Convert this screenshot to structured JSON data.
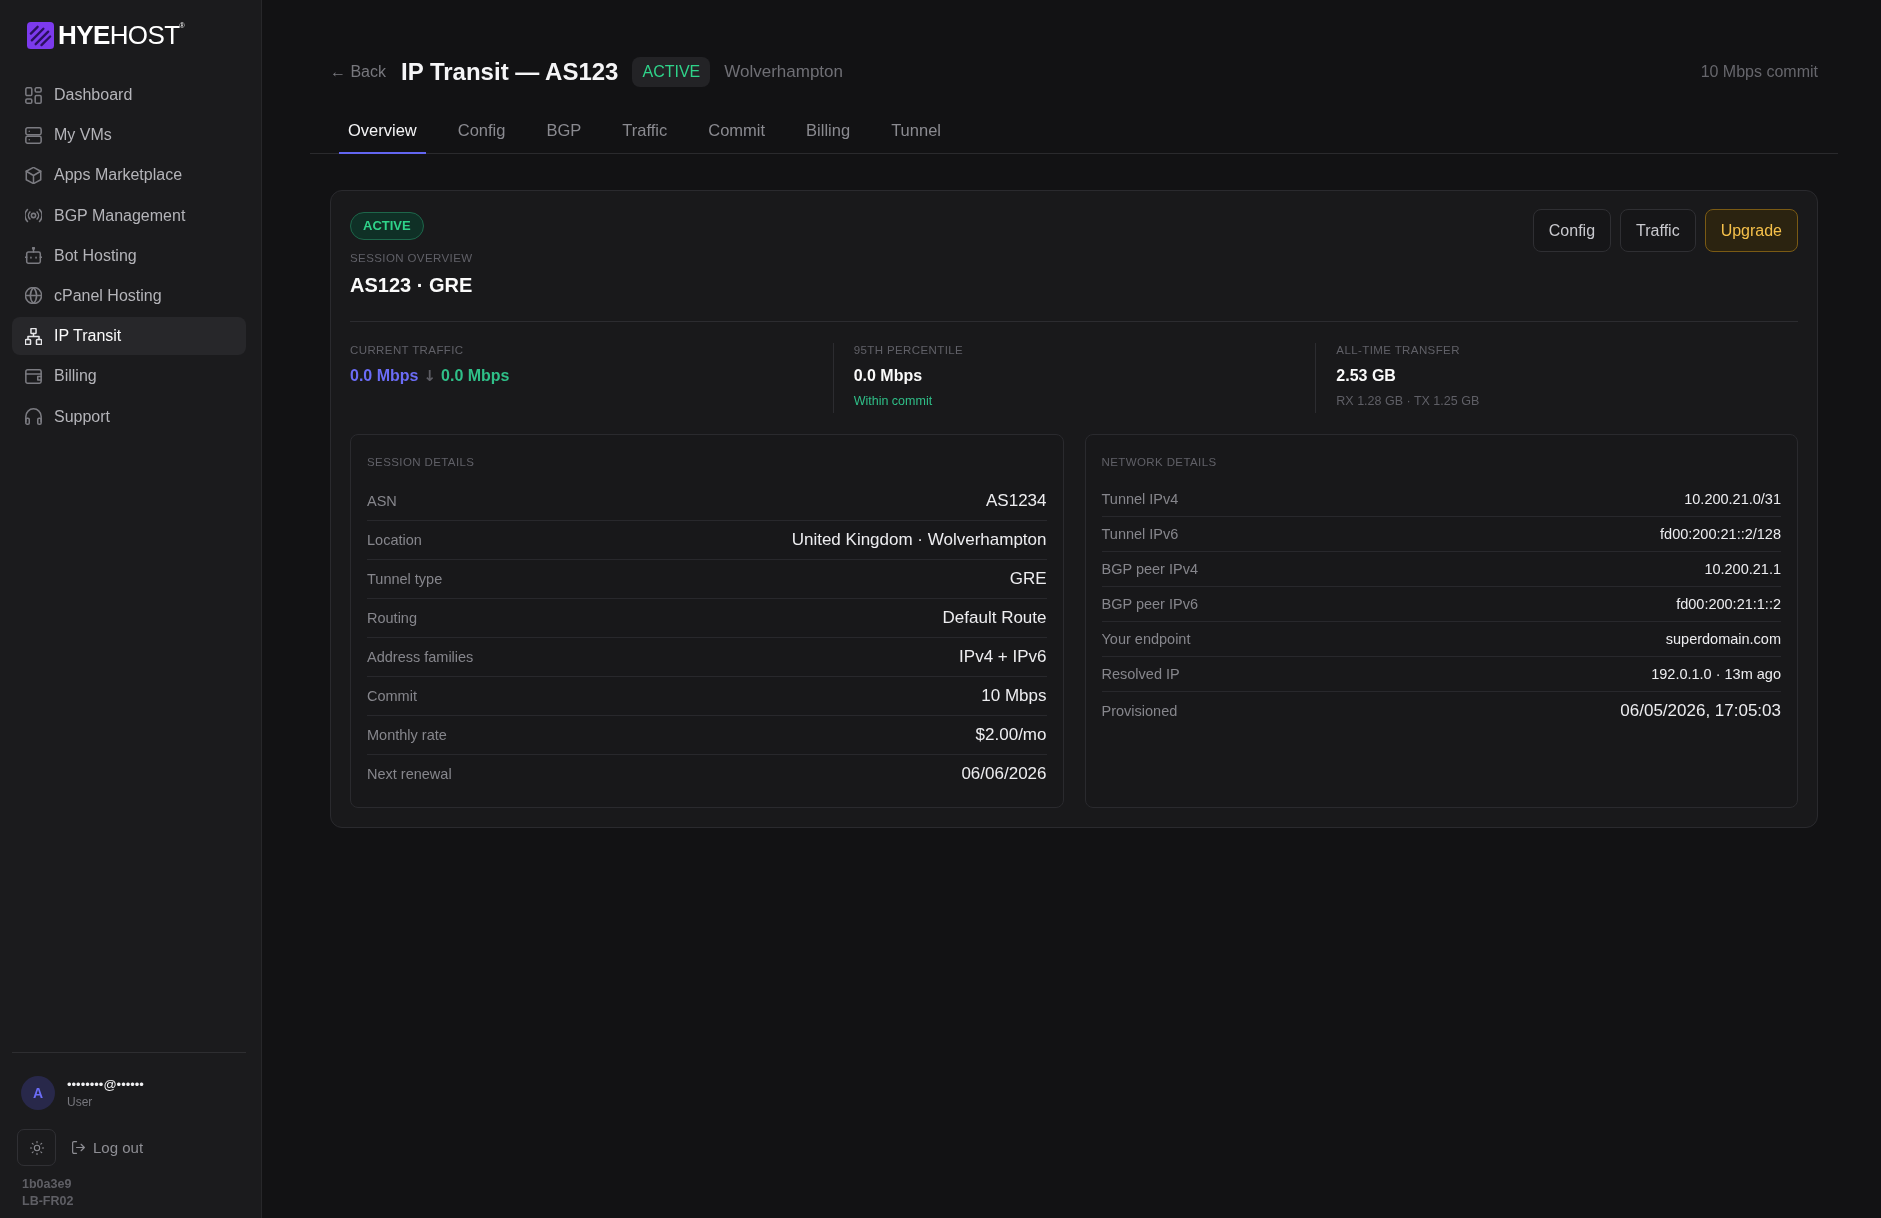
{
  "sidebar": {
    "logo": "**HYE**HOST$^{®}$",
    "items": [
      {
        "label": "Dashboard",
        "selected": false
      },
      {
        "label": "My VMs",
        "selected": false
      },
      {
        "label": "Apps Marketplace",
        "selected": false
      },
      {
        "label": "BGP Management",
        "selected": false
      },
      {
        "label": "Bot Hosting",
        "selected": false
      },
      {
        "label": "cPanel Hosting",
        "selected": false
      },
      {
        "label": "IP Transit",
        "selected": true
      },
      {
        "label": "Billing",
        "selected": false
      },
      {
        "label": "Support",
        "selected": false
      }
    ],
    "user": {
      "avatar_letter": "A",
      "email": "••••••••@••••••",
      "role": "User"
    },
    "logout": "Log out",
    "build": [
      "1b0a3e9",
      "LB-FR02"
    ]
  },
  "header": {
    "back": "← Back",
    "title": "IP Transit — AS123",
    "status": "ACTIVE",
    "location": "Wolverhampton",
    "commit": "10 Mbps commit"
  },
  "tabs": [
    {
      "label": "Overview",
      "selected": true
    },
    {
      "label": "Config",
      "selected": false
    },
    {
      "label": "BGP",
      "selected": false
    },
    {
      "label": "Traffic",
      "selected": false
    },
    {
      "label": "Commit",
      "selected": false
    },
    {
      "label": "Billing",
      "selected": false
    },
    {
      "label": "Tunnel",
      "selected": false
    }
  ],
  "overview": {
    "status": "ACTIVE",
    "eyebrow": "SESSION OVERVIEW",
    "title": "AS123 · GRE",
    "buttons": [
      {
        "label": "Config",
        "kind": "default"
      },
      {
        "label": "Traffic",
        "kind": "default"
      },
      {
        "label": "Upgrade",
        "kind": "accent"
      }
    ],
    "stats": [
      {
        "label": "CURRENT TRAFFIC",
        "parts": [
          {
            "text": "0.0 Mbps",
            "color": "#6b6cf6"
          },
          {
            "text": "↓",
            "color": "#5c5c63"
          },
          {
            "text": "0.0 Mbps",
            "color": "#2fbf88"
          }
        ]
      },
      {
        "label": "95TH PERCENTILE",
        "value": "0.0 Mbps",
        "note": {
          "text": "Within commit",
          "kind": "ok"
        }
      },
      {
        "label": "ALL-TIME TRANSFER",
        "value": "2.53 GB",
        "note": {
          "text": "RX 1.28 GB · TX 1.25 GB",
          "kind": "muted"
        }
      }
    ],
    "panels": [
      {
        "title": "SESSION DETAILS",
        "rows": [
          {
            "label": "ASN",
            "value": "AS1234",
            "kind": "regular"
          },
          {
            "label": "Location",
            "value": "United Kingdom · Wolverhampton",
            "kind": "regular"
          },
          {
            "label": "Tunnel type",
            "value": "GRE",
            "kind": "regular"
          },
          {
            "label": "Routing",
            "value": "Default Route",
            "kind": "regular"
          },
          {
            "label": "Address families",
            "value": "IPv4 + IPv6",
            "kind": "regular"
          },
          {
            "label": "Commit",
            "value": "10 Mbps",
            "kind": "regular"
          },
          {
            "label": "Monthly rate",
            "value": "$2.00/mo",
            "kind": "regular"
          },
          {
            "label": "Next renewal",
            "value": "06/06/2026",
            "kind": "regular"
          }
        ]
      },
      {
        "title": "NETWORK DETAILS",
        "rows": [
          {
            "label": "Tunnel IPv4",
            "value": "10.200.21.0/31",
            "kind": "compact"
          },
          {
            "label": "Tunnel IPv6",
            "value": "fd00:200:21::2/128",
            "kind": "compact"
          },
          {
            "label": "BGP peer IPv4",
            "value": "10.200.21.1",
            "kind": "compact"
          },
          {
            "label": "BGP peer IPv6",
            "value": "fd00:200:21:1::2",
            "kind": "compact"
          },
          {
            "label": "Your endpoint",
            "value": "superdomain.com",
            "kind": "compact"
          },
          {
            "label": "Resolved IP",
            "value": "192.0.1.0 · 13m ago",
            "kind": "compact"
          },
          {
            "label": "Provisioned",
            "value": "06/05/2026, 17:05:03",
            "kind": "regular"
          }
        ]
      }
    ]
  }
}
